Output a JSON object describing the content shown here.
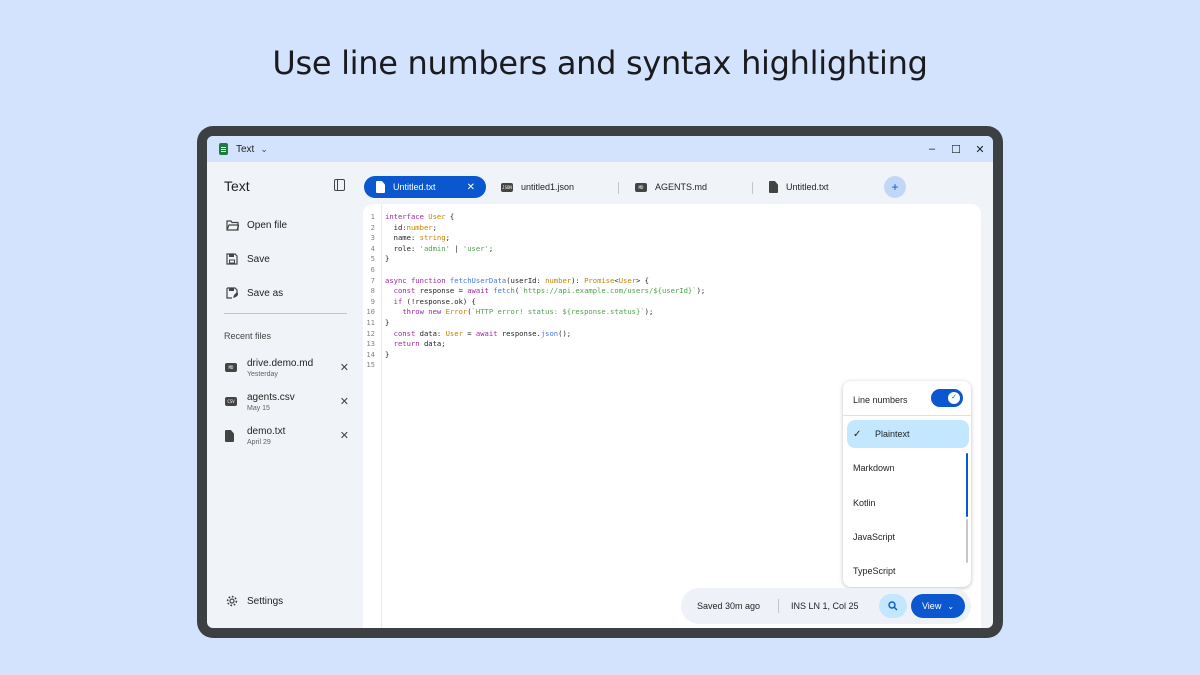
{
  "headline": "Use line numbers and syntax highlighting",
  "titlebar": {
    "app_name": "Text",
    "minimize": "–",
    "maximize": "☐",
    "close": "✕"
  },
  "sidebar": {
    "title": "Text",
    "items": [
      {
        "label": "Open file",
        "icon": "folder-open-icon"
      },
      {
        "label": "Save",
        "icon": "save-icon"
      },
      {
        "label": "Save as",
        "icon": "save-as-icon"
      }
    ],
    "recent_title": "Recent files",
    "recent": [
      {
        "name": "drive.demo.md",
        "date": "Yesterday",
        "badge": "MD"
      },
      {
        "name": "agents.csv",
        "date": "May 15",
        "badge": "CSV"
      },
      {
        "name": "demo.txt",
        "date": "April 29",
        "badge": ""
      }
    ],
    "settings_label": "Settings"
  },
  "tabs": [
    {
      "label": "Untitled.txt",
      "active": true
    },
    {
      "label": "untitled1.json",
      "active": false
    },
    {
      "label": "AGENTS.md",
      "active": false
    },
    {
      "label": "Untitled.txt",
      "active": false
    }
  ],
  "editor": {
    "lines": [
      "interface User {",
      "  id:number;",
      "  name: string;",
      "  role: 'admin' | 'user';",
      "}",
      "",
      "async function fetchUserData(userId: number): Promise<User> {",
      "  const response = await fetch(`https://api.example.com/users/${userId}`);",
      "  if (!response.ok) {",
      "    throw new Error(`HTTP error! status: ${response.status}`);",
      "}",
      "  const data: User = await response.json();",
      "  return data;",
      "}",
      ""
    ]
  },
  "popup": {
    "line_numbers_label": "Line numbers",
    "line_numbers_on": true,
    "options": [
      "Plaintext",
      "Markdown",
      "Kotlin",
      "JavaScript",
      "TypeScript"
    ],
    "selected": "Plaintext"
  },
  "status": {
    "saved": "Saved 30m ago",
    "position": "INS  LN 1, Col 25",
    "view_label": "View"
  },
  "colors": {
    "accent": "#0b57d0",
    "background": "#d3e3fd",
    "selected": "#c2e7ff"
  }
}
